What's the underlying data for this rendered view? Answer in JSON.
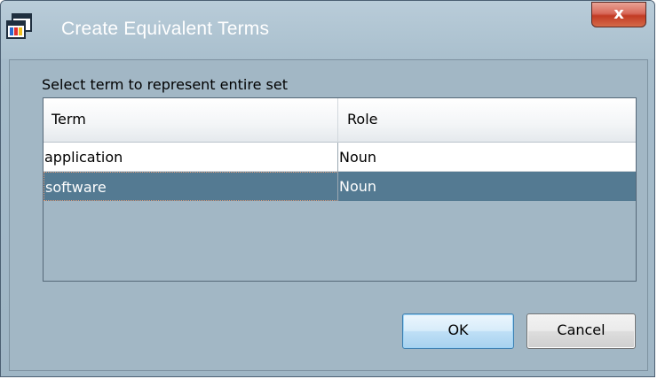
{
  "window": {
    "title": "Create Equivalent Terms",
    "close_label": "x",
    "icon": "window-app-icon"
  },
  "dialog": {
    "instruction": "Select term to represent entire set",
    "table": {
      "columns": [
        "Term",
        "Role"
      ],
      "rows": [
        {
          "term": "application",
          "role": "Noun",
          "selected": false
        },
        {
          "term": "software",
          "role": "Noun",
          "selected": true
        }
      ]
    },
    "buttons": {
      "ok": "OK",
      "cancel": "Cancel"
    }
  },
  "colors": {
    "selection": "#547a92",
    "close_button": "#c23b24",
    "frame": "#a2b7c5"
  }
}
